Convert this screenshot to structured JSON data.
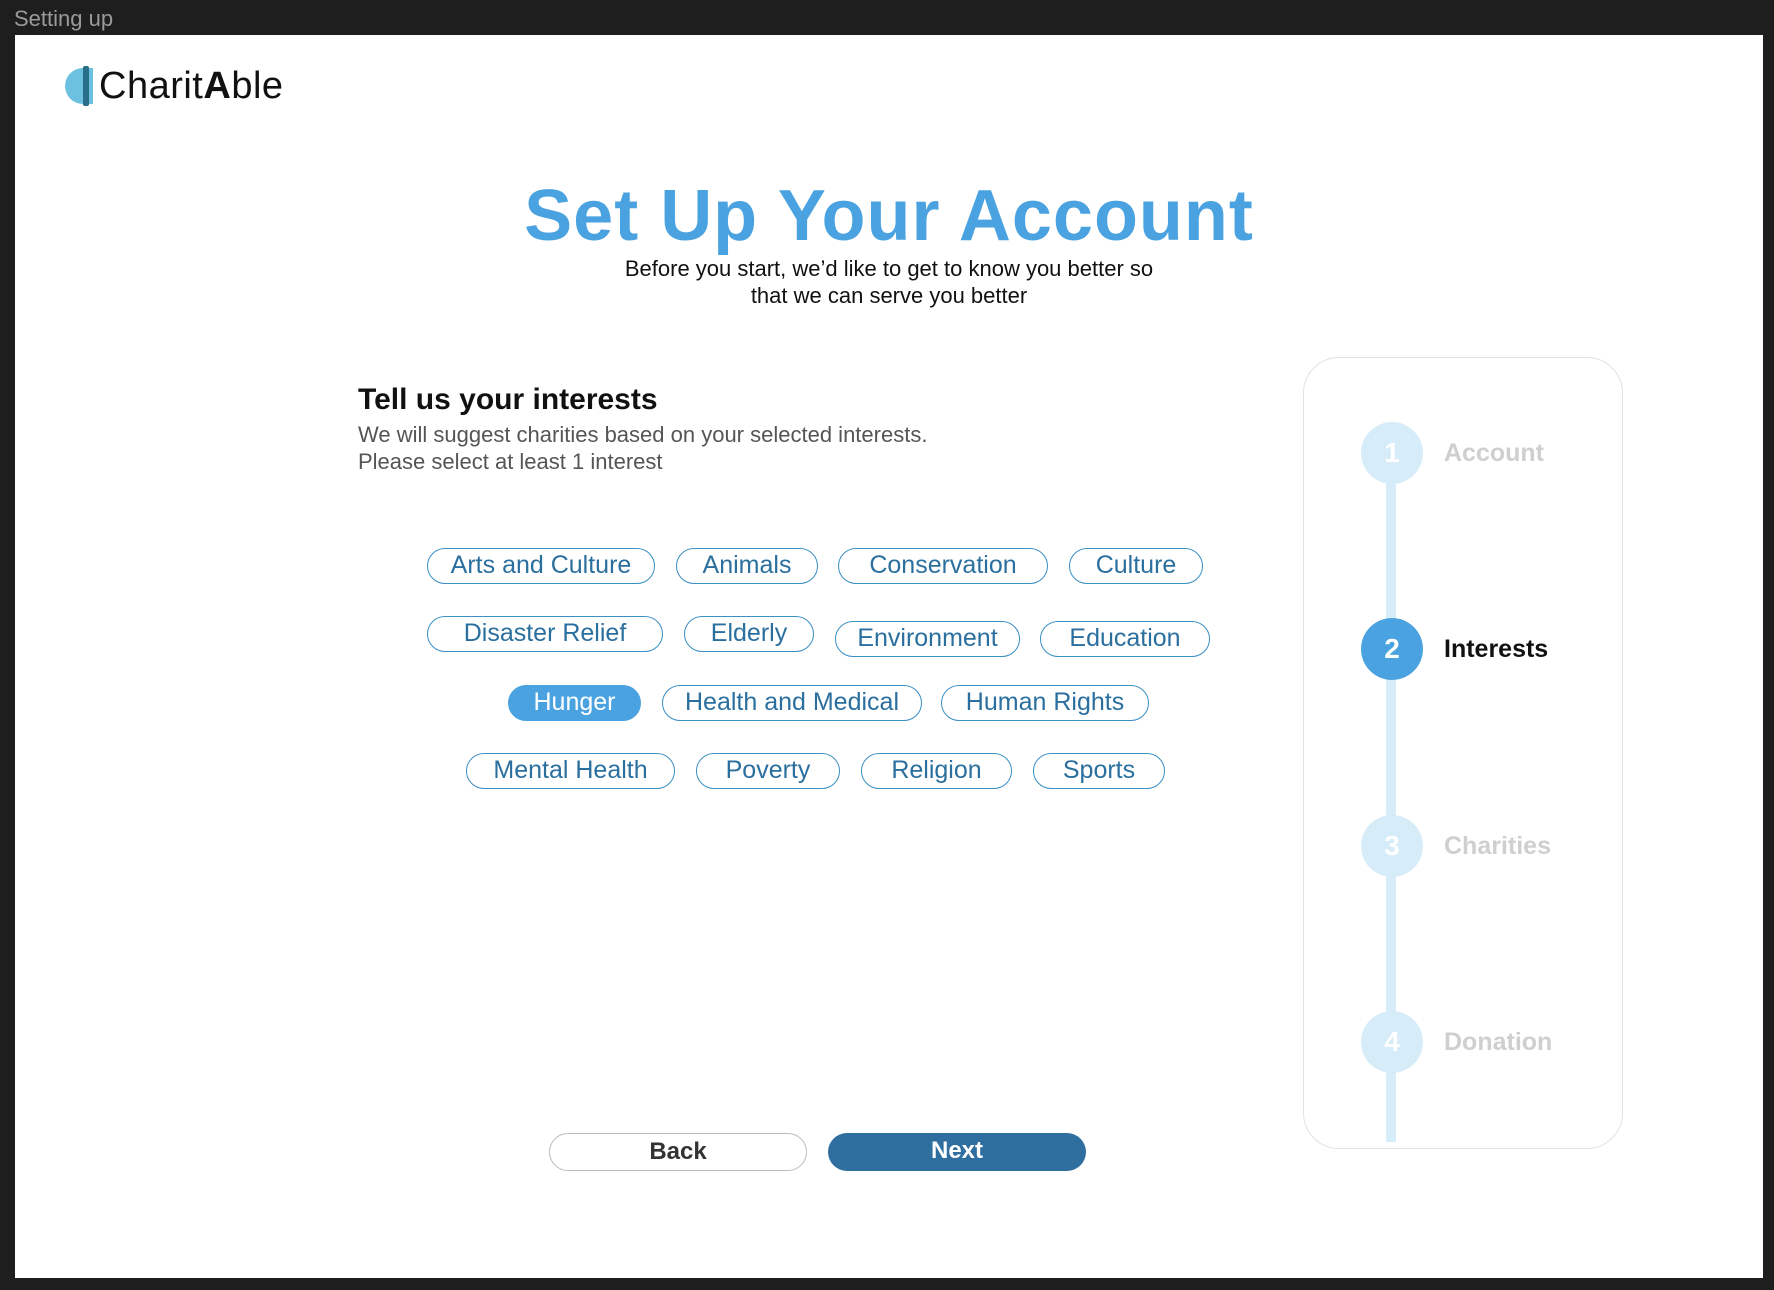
{
  "window": {
    "title": "Setting up"
  },
  "logo": {
    "part1": "Charit",
    "part2": "A",
    "part3": "ble"
  },
  "header": {
    "title": "Set Up Your Account",
    "subtitle_line1": "Before you start, we’d like to get to know you better so",
    "subtitle_line2": "that we can serve you better"
  },
  "interests": {
    "heading": "Tell us your interests",
    "desc_line1": "We will suggest charities based on your selected interests.",
    "desc_line2": "Please select at least 1 interest",
    "chips": [
      {
        "label": "Arts and Culture",
        "selected": false
      },
      {
        "label": "Animals",
        "selected": false
      },
      {
        "label": "Conservation",
        "selected": false
      },
      {
        "label": "Culture",
        "selected": false
      },
      {
        "label": "Disaster Relief",
        "selected": false
      },
      {
        "label": "Elderly",
        "selected": false
      },
      {
        "label": "Environment",
        "selected": false
      },
      {
        "label": "Education",
        "selected": false
      },
      {
        "label": "Hunger",
        "selected": true
      },
      {
        "label": "Health and Medical",
        "selected": false
      },
      {
        "label": "Human Rights",
        "selected": false
      },
      {
        "label": "Mental Health",
        "selected": false
      },
      {
        "label": "Poverty",
        "selected": false
      },
      {
        "label": "Religion",
        "selected": false
      },
      {
        "label": "Sports",
        "selected": false
      }
    ]
  },
  "buttons": {
    "back": "Back",
    "next": "Next"
  },
  "stepper": {
    "steps": [
      {
        "number": "1",
        "label": "Account",
        "active": false
      },
      {
        "number": "2",
        "label": "Interests",
        "active": true
      },
      {
        "number": "3",
        "label": "Charities",
        "active": false
      },
      {
        "number": "4",
        "label": "Donation",
        "active": false
      }
    ]
  },
  "colors": {
    "accent": "#4aa3e0",
    "primary_button": "#2f6f9f",
    "chip_text": "#2a6f9e",
    "step_inactive": "#d6ecf9"
  }
}
